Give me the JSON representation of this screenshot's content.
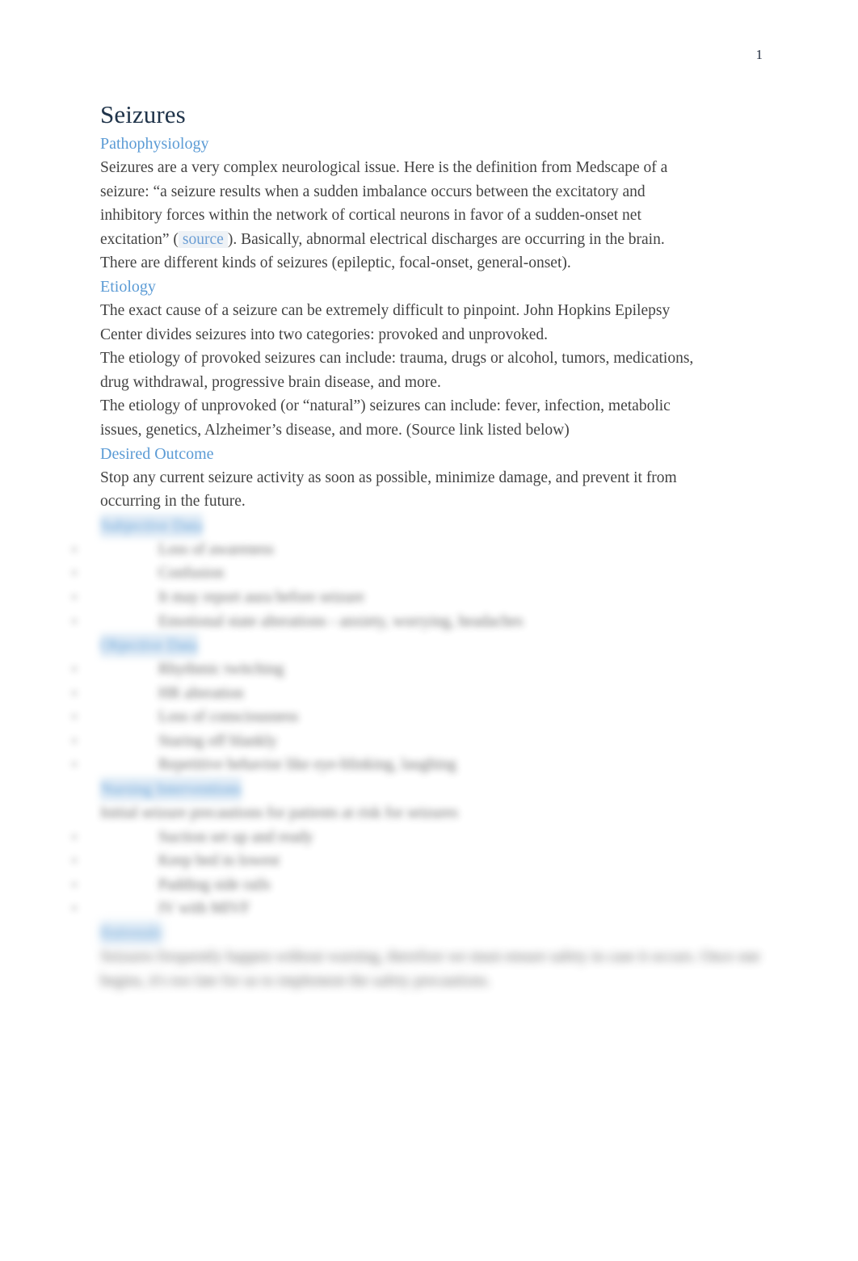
{
  "page": {
    "number": "1"
  },
  "document": {
    "title": "Seizures",
    "sections": {
      "pathophysiology": {
        "heading": "Pathophysiology",
        "body_before_link": "Seizures are a very complex neurological issue. Here is the definition from Medscape of a seizure: “a seizure results when a sudden imbalance occurs between the excitatory and inhibitory forces within the network of cortical neurons in favor of a sudden-onset net excitation” (",
        "link_label": "source",
        "body_after_link": "). Basically, abnormal electrical discharges are occurring in the brain. There are different kinds of seizures (epileptic, focal-onset, general-onset)."
      },
      "etiology": {
        "heading": "Etiology",
        "paragraphs": [
          "The exact cause of a seizure can be extremely difficult to pinpoint. John Hopkins Epilepsy Center divides seizures into two categories: provoked and unprovoked.",
          "The etiology of provoked seizures can include: trauma, drugs or alcohol, tumors, medications, drug withdrawal, progressive brain disease, and more.",
          "The etiology of unprovoked (or “natural”) seizures can include: fever, infection, metabolic issues, genetics, Alzheimer’s disease, and more. (Source link listed below)"
        ]
      },
      "desired_outcome": {
        "heading": "Desired Outcome",
        "paragraphs": [
          "Stop any current seizure activity as soon as possible, minimize damage, and prevent it from occurring in the future."
        ]
      },
      "subjective_data": {
        "heading": "Subjective Data",
        "items": [
          "Loss of awareness",
          "Confusion",
          "It may report aura before seizure",
          "Emotional state alterations - anxiety, worrying, headaches"
        ]
      },
      "objective_data": {
        "heading": "Objective Data",
        "items": [
          "Rhythmic twitching",
          "HR alteration",
          "Loss of consciousness",
          "Staring off blankly",
          "Repetitive behavior like eye-blinking, laughing"
        ]
      },
      "nursing_interventions": {
        "heading": "Nursing Interventions",
        "intro": "Initial seizure precautions for patients at risk for seizures",
        "items": [
          "Suction set up and ready",
          "Keep bed in lowest",
          "Padding side rails",
          "IV with MIVF"
        ]
      },
      "rationale": {
        "heading": "Rationale",
        "paragraphs": [
          "Seizures frequently happen without warning, therefore we must ensure safety in case it occurs. Once one begins, it's too late for us to implement the safety precautions."
        ]
      }
    }
  }
}
